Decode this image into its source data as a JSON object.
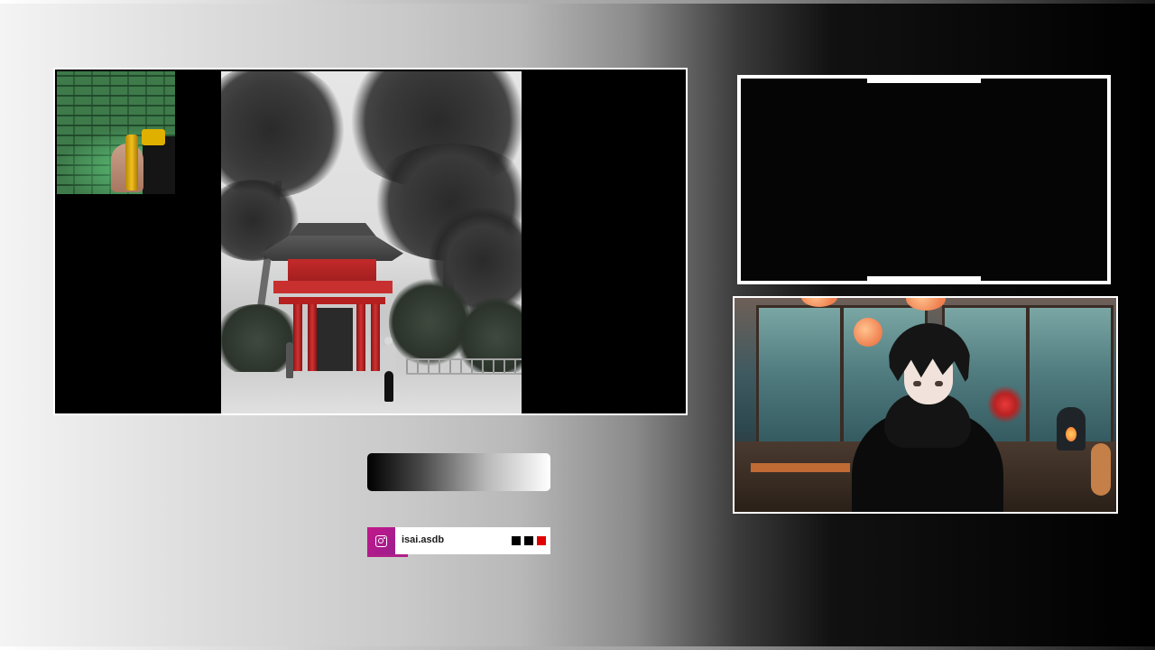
{
  "scene": {
    "main_video": {
      "description_visible": false
    },
    "facecam": {},
    "photo": {}
  },
  "social": {
    "platform_icon": "instagram-icon",
    "handle": "isai.asdb",
    "progress_fraction": 0.22,
    "squares": [
      {
        "color": "#000000"
      },
      {
        "color": "#000000"
      },
      {
        "color": "#e00000"
      }
    ],
    "accent_color": "#b01e88"
  },
  "colors": {
    "frame_border": "#ffffff",
    "gate_red": "#c42a2a"
  }
}
